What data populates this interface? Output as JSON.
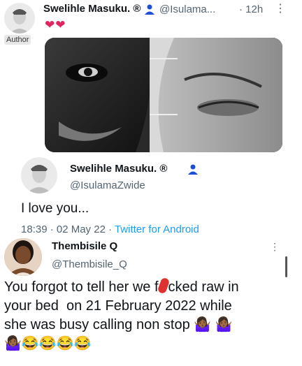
{
  "tweet": {
    "author_name": "Swelihle Masuku.",
    "registered_mark": "®",
    "handle": "@Isulama...",
    "time": "· 12h",
    "author_badge": "Author",
    "hearts": "❤❤",
    "icons": [
      "person-icon",
      "more-options-icon",
      "heart-icon"
    ]
  },
  "quote": {
    "author_name": "Swelihle Masuku.",
    "registered_mark": "®",
    "handle": "@IsulamaZwide",
    "text": "I love you...",
    "timestamp": "18:39 · 02 May 22 · ",
    "source": "Twitter for Android",
    "colors": {
      "link": "#1d9bf0",
      "muted": "#536471"
    }
  },
  "reply": {
    "author_name": "Thembisile Q",
    "handle": "@Thembisile_Q",
    "line1_before": "You forgot to tell her we f",
    "line1_after": "cked raw in",
    "line2": "your bed  on 21 February 2022 while",
    "line3": "she was busy calling non stop ",
    "line3_emojis": "🤷🏾‍♀️ 🤷🏾‍♀️",
    "line4_emojis": "🤷🏾‍♀️😂😂😂😂"
  }
}
